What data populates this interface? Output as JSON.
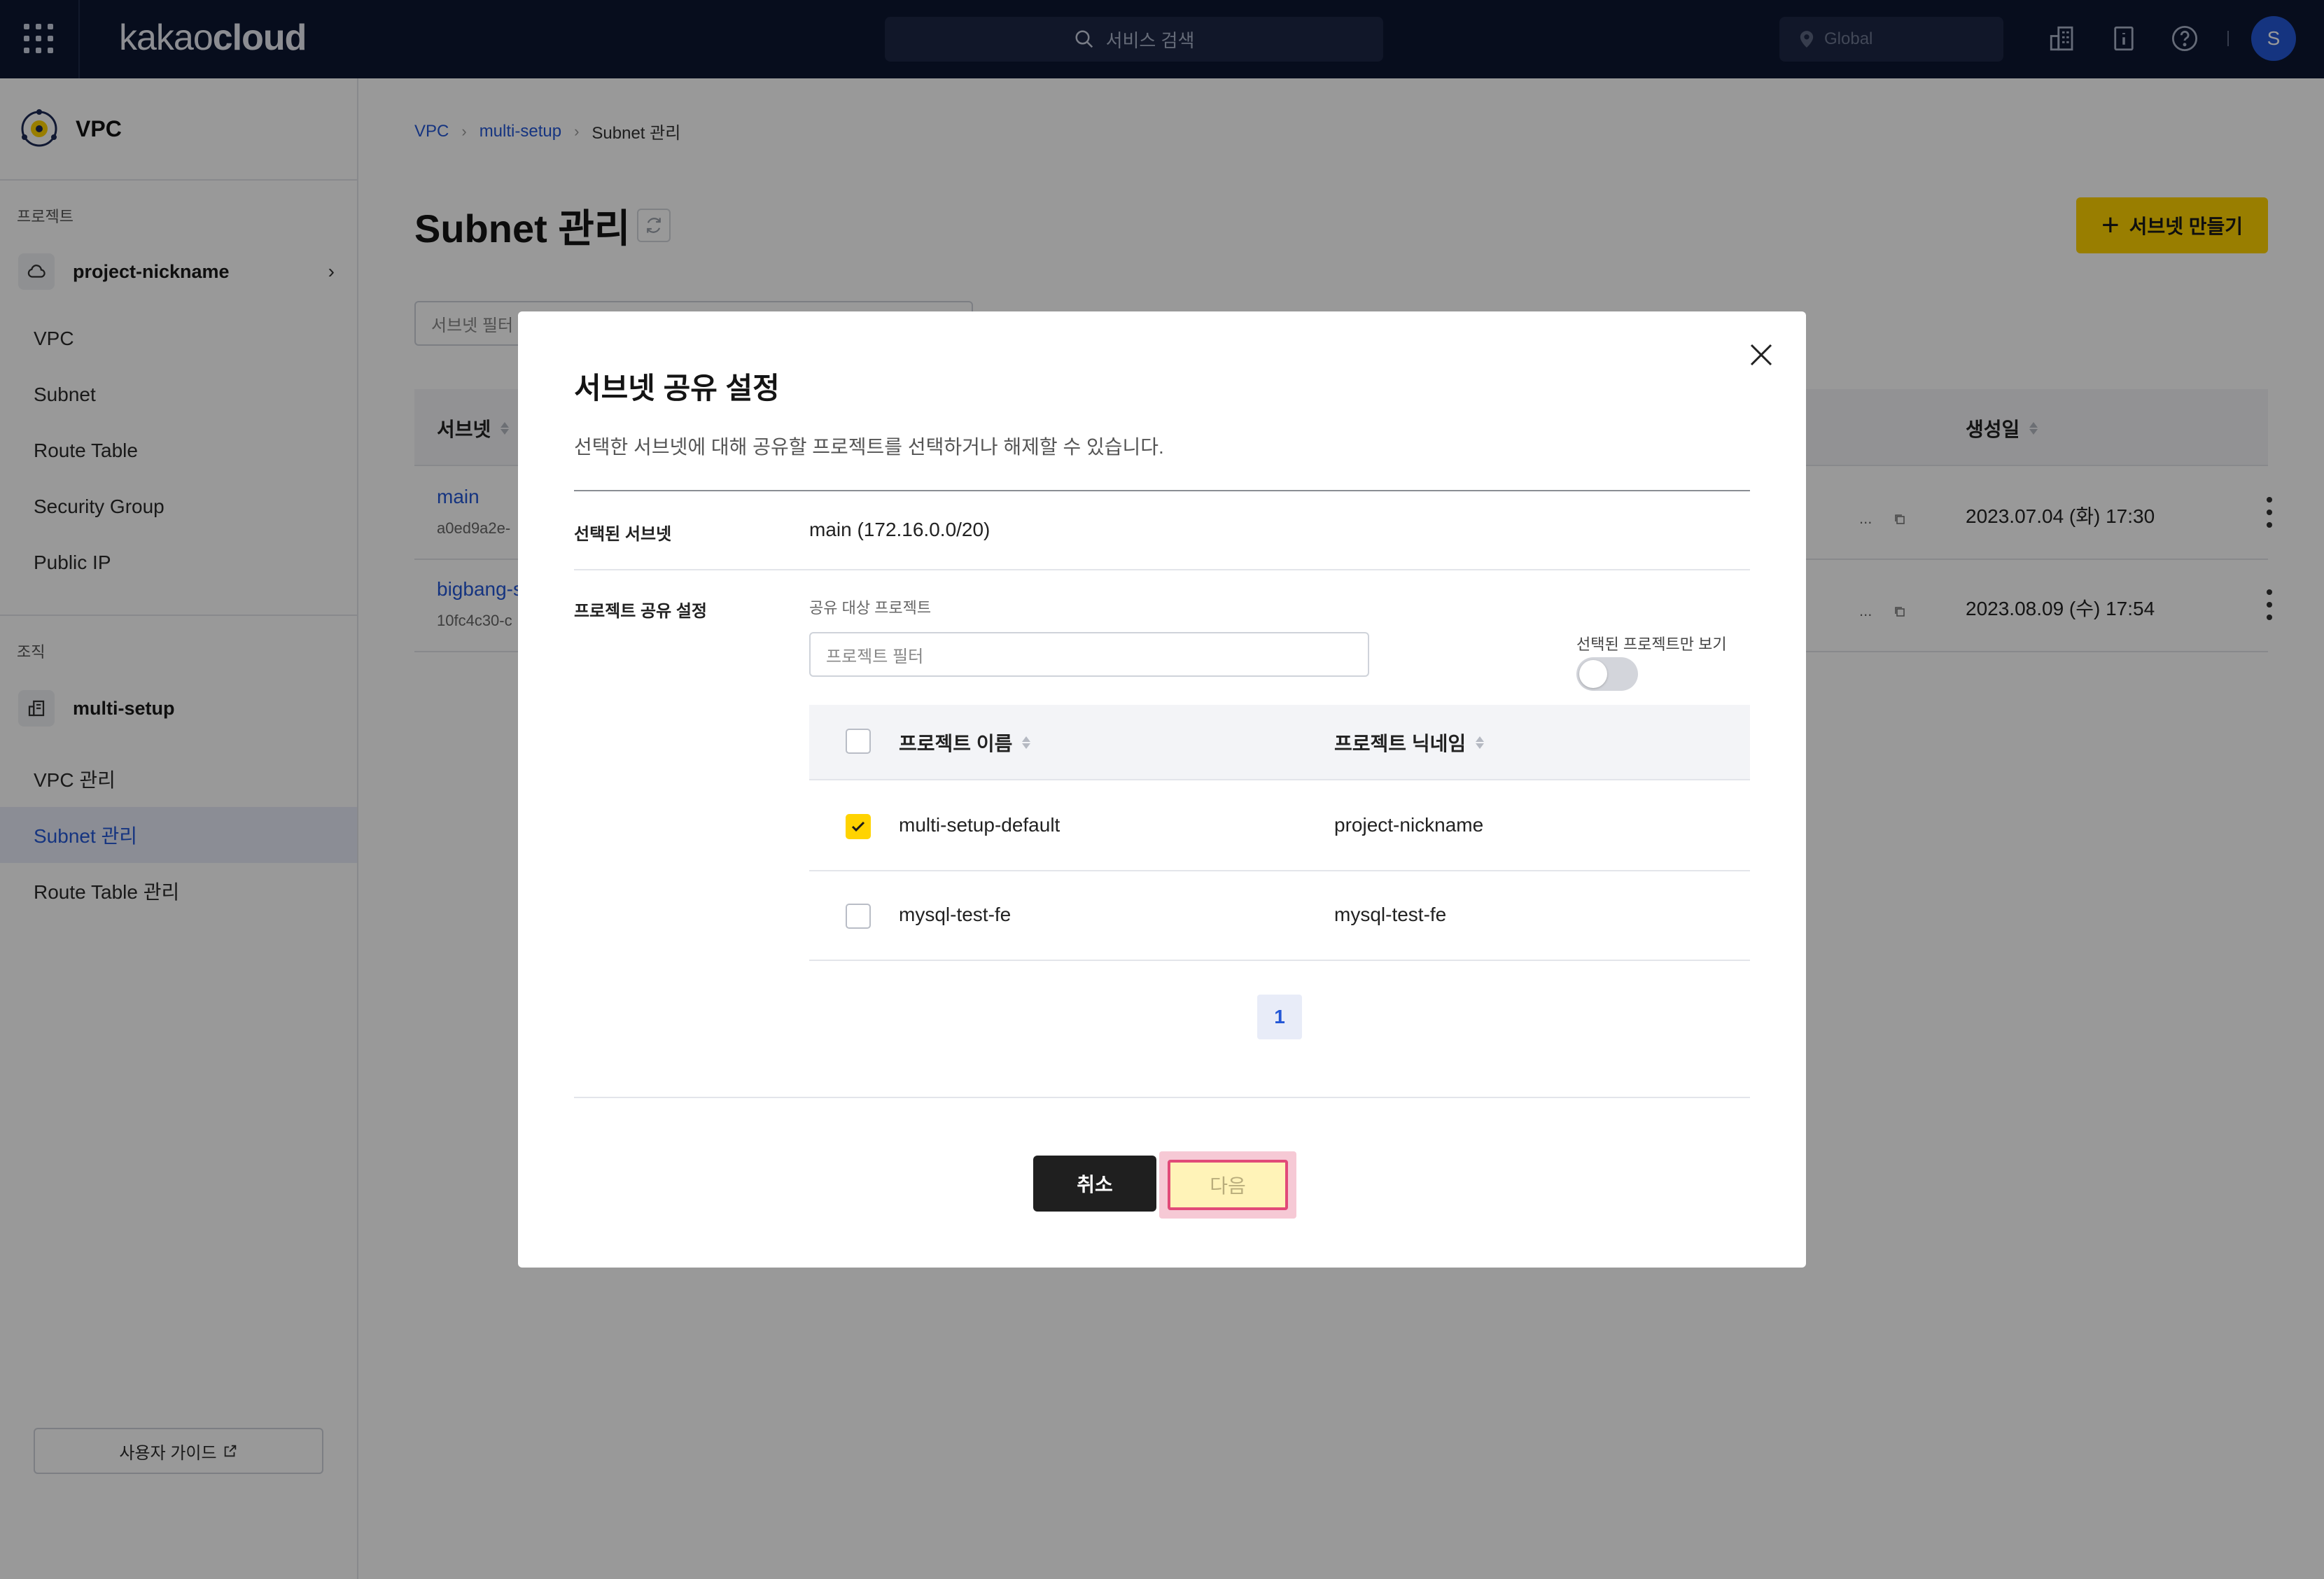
{
  "topbar": {
    "logo_light": "kakao",
    "logo_bold": "cloud",
    "search_placeholder": "서비스 검색",
    "region": "Global",
    "avatar_initial": "S"
  },
  "sidebar": {
    "service_name": "VPC",
    "project_section_label": "프로젝트",
    "project_name": "project-nickname",
    "project_nav": [
      "VPC",
      "Subnet",
      "Route Table",
      "Security Group",
      "Public IP"
    ],
    "org_section_label": "조직",
    "org_name": "multi-setup",
    "org_nav": [
      "VPC 관리",
      "Subnet 관리",
      "Route Table 관리"
    ],
    "active_item": "Subnet 관리",
    "guide_button": "사용자 가이드"
  },
  "main": {
    "breadcrumb": [
      "VPC",
      "multi-setup",
      "Subnet 관리"
    ],
    "title": "Subnet 관리",
    "create_button": "서브넷 만들기",
    "filter_placeholder": "서브넷 필터",
    "table": {
      "col_subnet": "서브넷",
      "col_created": "생성일",
      "rows": [
        {
          "name": "main",
          "id": "a0ed9a2e-",
          "truncated": "...",
          "created": "2023.07.04 (화) 17:30"
        },
        {
          "name": "bigbang-s",
          "id": "10fc4c30-c",
          "truncated": "...",
          "created": "2023.08.09 (수) 17:54"
        }
      ]
    }
  },
  "modal": {
    "title": "서브넷 공유 설정",
    "description": "선택한 서브넷에 대해 공유할 프로젝트를 선택하거나 해제할 수 있습니다.",
    "selected_subnet_label": "선택된 서브넷",
    "selected_subnet_value": "main (172.16.0.0/20)",
    "share_label": "프로젝트 공유 설정",
    "target_label": "공유 대상 프로젝트",
    "project_filter_placeholder": "프로젝트 필터",
    "toggle_label": "선택된 프로젝트만 보기",
    "toggle_on": false,
    "col_project_name": "프로젝트 이름",
    "col_project_nickname": "프로젝트 닉네임",
    "projects": [
      {
        "name": "multi-setup-default",
        "nickname": "project-nickname",
        "checked": true
      },
      {
        "name": "mysql-test-fe",
        "nickname": "mysql-test-fe",
        "checked": false
      }
    ],
    "current_page": "1",
    "cancel_button": "취소",
    "next_button": "다음"
  },
  "colors": {
    "topbar_bg": "#0d1631",
    "accent_yellow": "#ffd300",
    "link_blue": "#2457d6",
    "highlight_pink": "#e14a78"
  }
}
